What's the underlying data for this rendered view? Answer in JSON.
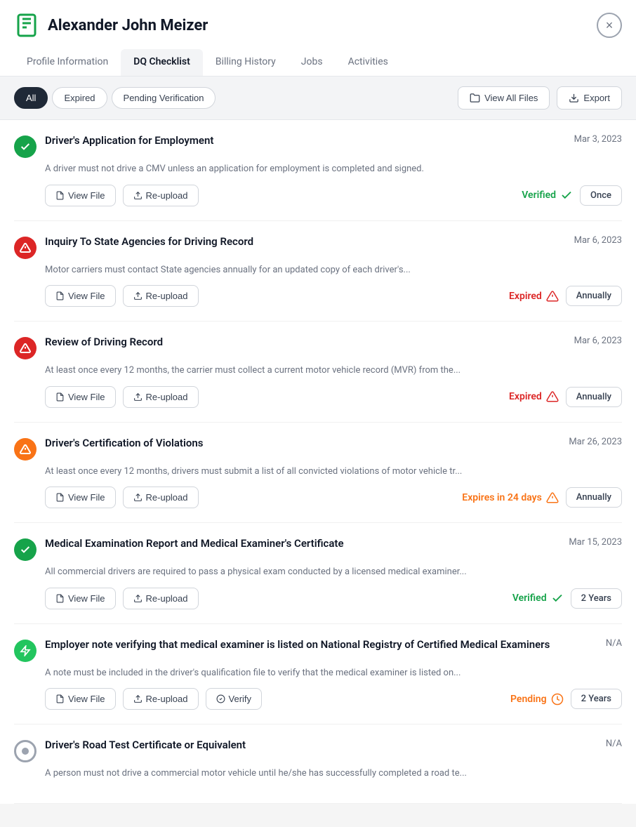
{
  "header": {
    "title": "Alexander John Meizer",
    "close_label": "×"
  },
  "tabs": [
    {
      "id": "profile",
      "label": "Profile Information",
      "active": false
    },
    {
      "id": "dq",
      "label": "DQ Checklist",
      "active": true
    },
    {
      "id": "billing",
      "label": "Billing History",
      "active": false
    },
    {
      "id": "jobs",
      "label": "Jobs",
      "active": false
    },
    {
      "id": "activities",
      "label": "Activities",
      "active": false
    }
  ],
  "filters": {
    "all_label": "All",
    "expired_label": "Expired",
    "pending_label": "Pending Verification",
    "view_all_label": "View All Files",
    "export_label": "Export"
  },
  "checklist": [
    {
      "id": "item-1",
      "title": "Driver's Application for Employment",
      "date": "Mar 3, 2023",
      "description": "A driver must not drive a CMV unless an application for employment is completed and signed.",
      "status": "Verified",
      "status_type": "verified",
      "frequency": "Once",
      "icon_type": "green",
      "has_verify": false
    },
    {
      "id": "item-2",
      "title": "Inquiry To State Agencies for Driving Record",
      "date": "Mar 6, 2023",
      "description": "Motor carriers must contact State agencies annually for an updated copy of each driver's...",
      "status": "Expired",
      "status_type": "expired",
      "frequency": "Annually",
      "icon_type": "red",
      "has_verify": false
    },
    {
      "id": "item-3",
      "title": "Review of Driving Record",
      "date": "Mar 6, 2023",
      "description": "At least once every 12 months, the carrier must collect a current motor vehicle record (MVR) from the...",
      "status": "Expired",
      "status_type": "expired",
      "frequency": "Annually",
      "icon_type": "red",
      "has_verify": false
    },
    {
      "id": "item-4",
      "title": "Driver's Certification of Violations",
      "date": "Mar 26, 2023",
      "description": "At least once every 12 months, drivers must submit a list of all convicted violations of motor vehicle tr...",
      "status": "Expires in 24 days",
      "status_type": "expires-soon",
      "frequency": "Annually",
      "icon_type": "orange",
      "has_verify": false
    },
    {
      "id": "item-5",
      "title": "Medical Examination Report and Medical Examiner's Certificate",
      "date": "Mar 15, 2023",
      "description": "All commercial drivers are required to pass a physical exam conducted by a licensed medical examiner...",
      "status": "Verified",
      "status_type": "verified",
      "frequency": "2 Years",
      "icon_type": "green",
      "has_verify": false
    },
    {
      "id": "item-6",
      "title": "Employer note verifying that medical examiner is listed on National Registry of Certified Medical Examiners",
      "date": "N/A",
      "description": "A note must be included in the driver's qualification file to verify that the medical examiner is listed on...",
      "status": "Pending",
      "status_type": "pending",
      "frequency": "2 Years",
      "icon_type": "lightning",
      "has_verify": true
    },
    {
      "id": "item-7",
      "title": "Driver's Road Test Certificate or Equivalent",
      "date": "N/A",
      "description": "A person must not drive a commercial motor vehicle until he/she has successfully completed a road te...",
      "status": "",
      "status_type": "none",
      "frequency": "",
      "icon_type": "gray",
      "has_verify": false
    }
  ]
}
